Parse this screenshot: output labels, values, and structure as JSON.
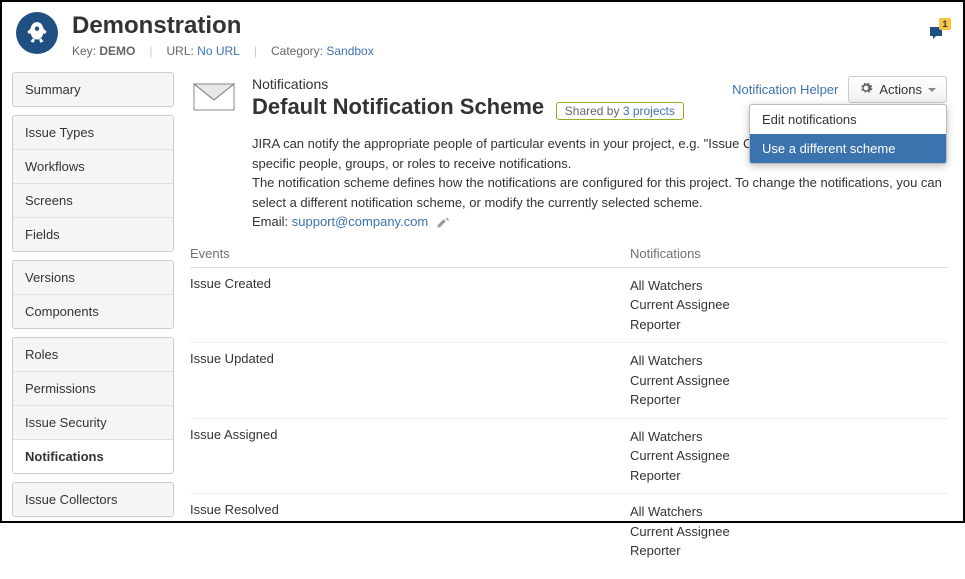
{
  "header": {
    "title": "Demonstration",
    "key_label": "Key:",
    "key_value": "DEMO",
    "url_label": "URL:",
    "url_value": "No URL",
    "category_label": "Category:",
    "category_value": "Sandbox",
    "badge_count": "1"
  },
  "sidebar": {
    "g1": [
      "Summary"
    ],
    "g2": [
      "Issue Types",
      "Workflows",
      "Screens",
      "Fields"
    ],
    "g3": [
      "Versions",
      "Components"
    ],
    "g4": [
      "Roles",
      "Permissions",
      "Issue Security",
      "Notifications"
    ],
    "g5": [
      "Issue Collectors"
    ]
  },
  "main": {
    "crumb": "Notifications",
    "title": "Default Notification Scheme",
    "shared_label": "Shared by",
    "shared_link": "3 projects",
    "helper": "Notification Helper",
    "actions_label": "Actions",
    "menu1": "Edit notifications",
    "menu2": "Use a different scheme",
    "p1": "JIRA can notify the appropriate people of particular events in your project, e.g. \"Issue Commented\". You can choose specific people, groups, or roles to receive notifications.",
    "p2": "The notification scheme defines how the notifications are configured for this project. To change the notifications, you can select a different notification scheme, or modify the currently selected scheme.",
    "email_label": "Email:",
    "email": "support@company.com",
    "th1": "Events",
    "th2": "Notifications",
    "rows": [
      {
        "event": "Issue Created",
        "r0": "All Watchers",
        "r1": "Current Assignee",
        "r2": "Reporter"
      },
      {
        "event": "Issue Updated",
        "r0": "All Watchers",
        "r1": "Current Assignee",
        "r2": "Reporter"
      },
      {
        "event": "Issue Assigned",
        "r0": "All Watchers",
        "r1": "Current Assignee",
        "r2": "Reporter"
      },
      {
        "event": "Issue Resolved",
        "r0": "All Watchers",
        "r1": "Current Assignee",
        "r2": "Reporter"
      }
    ]
  }
}
